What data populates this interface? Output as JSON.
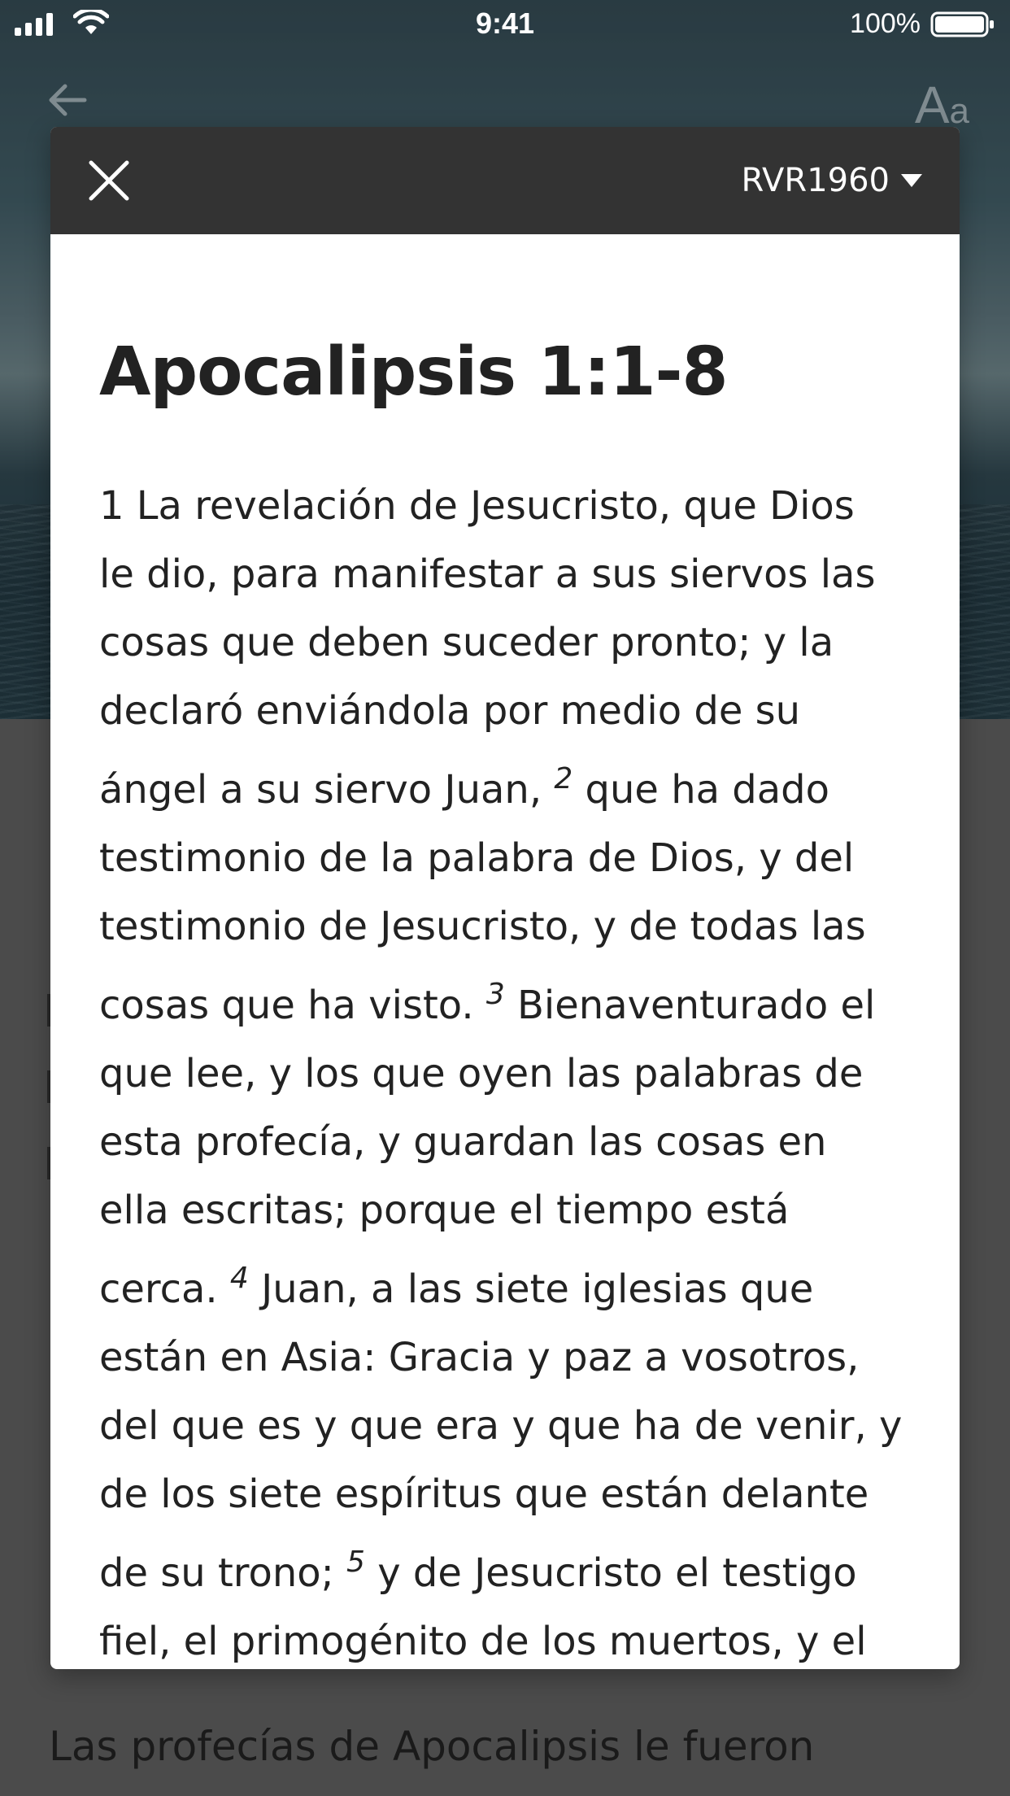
{
  "status_bar": {
    "time": "9:41",
    "battery": "100%"
  },
  "background": {
    "font_button": {
      "big": "A",
      "small": "a"
    },
    "text": "Las profecías de Apocalipsis le fueron"
  },
  "modal": {
    "version": "RVR1960",
    "title": "Apocalipsis 1:1-8",
    "lines": [
      {
        "pre": "1  La revelación de Jesucristo, que Dios",
        "num": "",
        "post": ""
      },
      {
        "pre": "le dio, para manifestar a sus siervos las",
        "num": "",
        "post": ""
      },
      {
        "pre": "cosas que deben suceder pronto; y la",
        "num": "",
        "post": ""
      },
      {
        "pre": "declaró enviándola por medio de su",
        "num": "",
        "post": ""
      },
      {
        "pre": "ángel a su siervo Juan, ",
        "num": "2",
        "post": " que ha dado"
      },
      {
        "pre": "testimonio de la palabra de Dios, y del",
        "num": "",
        "post": ""
      },
      {
        "pre": "testimonio de Jesucristo, y de todas las",
        "num": "",
        "post": ""
      },
      {
        "pre": "cosas que ha visto. ",
        "num": "3",
        "post": " Bienaventurado el"
      },
      {
        "pre": "que lee, y los que oyen las palabras de",
        "num": "",
        "post": ""
      },
      {
        "pre": "esta profecía, y guardan las cosas en",
        "num": "",
        "post": ""
      },
      {
        "pre": "ella escritas; porque el tiempo está",
        "num": "",
        "post": ""
      },
      {
        "pre": "cerca. ",
        "num": "4",
        "post": " Juan, a las siete iglesias que"
      },
      {
        "pre": "están en Asia: Gracia y paz a vosotros,",
        "num": "",
        "post": ""
      },
      {
        "pre": "del que es y que era y que ha de venir, y",
        "num": "",
        "post": ""
      },
      {
        "pre": "de los siete espíritus que están delante",
        "num": "",
        "post": ""
      },
      {
        "pre": "de su trono; ",
        "num": "5",
        "post": " y de Jesucristo el testigo"
      },
      {
        "pre": "fiel, el primogénito de los muertos, y el",
        "num": "",
        "post": ""
      }
    ]
  }
}
